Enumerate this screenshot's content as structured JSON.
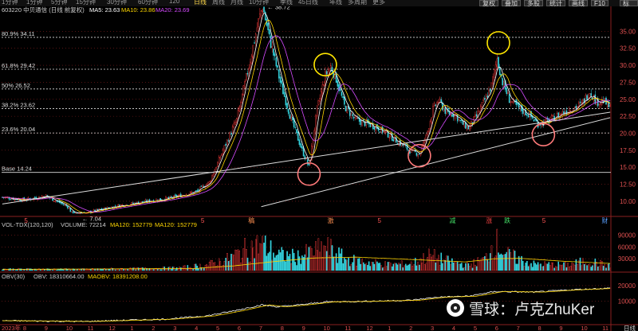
{
  "toolbar": {
    "periods": [
      {
        "label": "1分钟"
      },
      {
        "label": "1分钟"
      },
      {
        "label": "5分钟"
      },
      {
        "label": "15分钟"
      },
      {
        "label": "30分钟"
      },
      {
        "label": "60分钟"
      },
      {
        "label": "120"
      },
      {
        "label": "日线",
        "active": true
      },
      {
        "label": "周线"
      },
      {
        "label": "月线"
      },
      {
        "label": "10分钟"
      },
      {
        "label": "季线"
      },
      {
        "label": "45日线"
      },
      {
        "label": "年线"
      },
      {
        "label": "多周期"
      },
      {
        "label": "更多"
      }
    ],
    "right_buttons": [
      "复权",
      "叠加",
      "多股",
      "统计",
      "画线",
      "F10",
      "标记",
      "-",
      "□"
    ]
  },
  "header": {
    "code": "603220",
    "name": "中贝通信",
    "mode": "(日线 前复权)",
    "ma5": "MA5: 23.63",
    "ma10": "MA10: 23.86",
    "ma20": "MA20: 23.69"
  },
  "colors": {
    "up": "#ff3c3c",
    "down": "#35d5e0",
    "ma5": "#ffffff",
    "ma10": "#ffd700",
    "ma20": "#d64bff",
    "grid": "#8a1f1f",
    "fib": "#dddddd",
    "trend": "#dddddd",
    "circle_red": "#ff7a7a",
    "circle_yellow": "#ffe600"
  },
  "fib_levels": [
    {
      "label": "80.9% 34.11",
      "value": 34.11
    },
    {
      "label": "61.8% 29.42",
      "value": 29.42
    },
    {
      "label": "50% 26.52",
      "value": 26.52
    },
    {
      "label": "38.2% 23.62",
      "value": 23.62
    },
    {
      "label": "23.6% 20.04",
      "value": 20.04
    },
    {
      "label": "Base 14.24",
      "value": 14.24
    }
  ],
  "annotations": {
    "high": "38.72",
    "low": "7.04"
  },
  "event_markers": [
    {
      "label": "5",
      "pos": 0.04
    },
    {
      "label": "5",
      "pos": 0.33
    },
    {
      "label": "稿",
      "pos": 0.41
    },
    {
      "label": "激",
      "pos": 0.54
    },
    {
      "label": "5",
      "pos": 0.62
    },
    {
      "label": "减",
      "pos": 0.74
    },
    {
      "label": "涨",
      "pos": 0.8
    },
    {
      "label": "跌",
      "pos": 0.83
    },
    {
      "label": "5",
      "pos": 0.89
    },
    {
      "label": "财",
      "pos": 0.99
    }
  ],
  "volume_header": {
    "title": "VOL-TDX(120,120)",
    "volume": "VOLUME: 72214",
    "ma120a": "MA120: 152779",
    "ma120b": "MA120: 152779"
  },
  "obv_header": {
    "title": "OBV(30)",
    "obv": "OBV: 18310664.00",
    "maobv": "MAOBV: 18391208.00"
  },
  "chart_data": {
    "type": "candlestick",
    "price_axis": {
      "ticks": [
        35.0,
        32.5,
        30.0,
        27.5,
        25.0,
        22.5,
        20.0,
        17.5,
        15.0,
        12.5,
        10.0
      ],
      "ylim": [
        8.0,
        37.5
      ]
    },
    "volume_axis": {
      "ticks": [
        90000,
        60000,
        30000
      ],
      "ylim": [
        0,
        105000
      ]
    },
    "obv_axis": {
      "ticks": [
        20000000,
        10000000
      ],
      "tick_labels": [
        "20000",
        "10000"
      ],
      "ylim": [
        -4000000,
        23000000
      ]
    },
    "x_ticks": [
      "2023年",
      "8",
      "9",
      "10",
      "11",
      "12",
      "1",
      "2",
      "3",
      "4",
      "5",
      "6",
      "7",
      "8",
      "9",
      "10",
      "11",
      "12",
      "1",
      "2",
      "3",
      "4",
      "5",
      "6",
      "7",
      "8",
      "9",
      "10",
      "11",
      "日线"
    ],
    "price_anchors": [
      [
        0,
        10.6
      ],
      [
        16,
        10.2
      ],
      [
        32,
        10.8
      ],
      [
        48,
        9.2
      ],
      [
        55,
        7.04
      ],
      [
        64,
        8.4
      ],
      [
        84,
        9.3
      ],
      [
        104,
        9.9
      ],
      [
        124,
        10.5
      ],
      [
        142,
        11.4
      ],
      [
        152,
        12.8
      ],
      [
        162,
        17.5
      ],
      [
        172,
        22.0
      ],
      [
        180,
        29.0
      ],
      [
        188,
        36.5
      ],
      [
        191,
        38.72
      ],
      [
        196,
        34.0
      ],
      [
        204,
        27.5
      ],
      [
        212,
        22.0
      ],
      [
        220,
        17.5
      ],
      [
        225,
        15.0
      ],
      [
        231,
        23.5
      ],
      [
        237,
        28.5
      ],
      [
        241,
        29.8
      ],
      [
        245,
        28.0
      ],
      [
        251,
        24.0
      ],
      [
        259,
        22.0
      ],
      [
        266,
        21.5
      ],
      [
        274,
        21.0
      ],
      [
        282,
        20.0
      ],
      [
        292,
        18.5
      ],
      [
        300,
        17.3
      ],
      [
        306,
        17.0
      ],
      [
        311,
        19.5
      ],
      [
        316,
        23.5
      ],
      [
        320,
        24.8
      ],
      [
        326,
        23.0
      ],
      [
        332,
        22.8
      ],
      [
        337,
        21.5
      ],
      [
        342,
        20.8
      ],
      [
        348,
        22.5
      ],
      [
        353,
        24.5
      ],
      [
        359,
        27.0
      ],
      [
        363,
        31.0
      ],
      [
        367,
        27.5
      ],
      [
        372,
        25.0
      ],
      [
        378,
        23.8
      ],
      [
        386,
        22.8
      ],
      [
        393,
        21.4
      ],
      [
        401,
        21.8
      ],
      [
        409,
        22.8
      ],
      [
        417,
        23.6
      ],
      [
        425,
        24.2
      ],
      [
        431,
        26.2
      ],
      [
        436,
        24.6
      ],
      [
        441,
        24.8
      ],
      [
        446,
        23.7
      ]
    ],
    "volume_anchors": [
      [
        0,
        4000
      ],
      [
        60,
        3500
      ],
      [
        130,
        7000
      ],
      [
        150,
        15000
      ],
      [
        165,
        30000
      ],
      [
        178,
        55000
      ],
      [
        190,
        72000
      ],
      [
        202,
        42000
      ],
      [
        216,
        36000
      ],
      [
        226,
        48000
      ],
      [
        238,
        62000
      ],
      [
        252,
        30000
      ],
      [
        282,
        16000
      ],
      [
        300,
        18000
      ],
      [
        314,
        40000
      ],
      [
        326,
        26000
      ],
      [
        342,
        14000
      ],
      [
        354,
        30000
      ],
      [
        362,
        82000
      ],
      [
        370,
        42000
      ],
      [
        390,
        17000
      ],
      [
        414,
        15000
      ],
      [
        430,
        26000
      ],
      [
        446,
        12000
      ]
    ],
    "volume_ma120_anchors": [
      [
        0,
        3000
      ],
      [
        140,
        5000
      ],
      [
        170,
        12000
      ],
      [
        200,
        23000
      ],
      [
        230,
        32000
      ],
      [
        260,
        34000
      ],
      [
        300,
        28000
      ],
      [
        340,
        22000
      ],
      [
        362,
        30000
      ],
      [
        380,
        31000
      ],
      [
        410,
        24000
      ],
      [
        446,
        18000
      ]
    ],
    "obv_anchors": [
      [
        0,
        -2500000
      ],
      [
        60,
        -3000000
      ],
      [
        120,
        -1500000
      ],
      [
        150,
        600000
      ],
      [
        170,
        3800000
      ],
      [
        190,
        7600000
      ],
      [
        202,
        6400000
      ],
      [
        218,
        7600000
      ],
      [
        238,
        9600000
      ],
      [
        260,
        9800000
      ],
      [
        300,
        10600000
      ],
      [
        320,
        12600000
      ],
      [
        342,
        13200000
      ],
      [
        362,
        16200000
      ],
      [
        390,
        15800000
      ],
      [
        420,
        17400000
      ],
      [
        446,
        18310664
      ]
    ],
    "trendlines": [
      {
        "from": [
          0,
          9.6
        ],
        "to": [
          446,
          23.1
        ]
      },
      {
        "from": [
          190,
          9.2
        ],
        "to": [
          446,
          22.3
        ]
      }
    ],
    "circles": [
      {
        "index": 225,
        "value": 14.0,
        "color": "red"
      },
      {
        "index": 306,
        "value": 16.7,
        "color": "red"
      },
      {
        "index": 397,
        "value": 19.8,
        "color": "red"
      },
      {
        "index": 237,
        "value": 30.1,
        "color": "yellow"
      },
      {
        "index": 364,
        "value": 33.3,
        "color": "yellow"
      }
    ],
    "n_bars": 447
  },
  "watermark": {
    "text": "雪球：卢克ZhuKer"
  }
}
